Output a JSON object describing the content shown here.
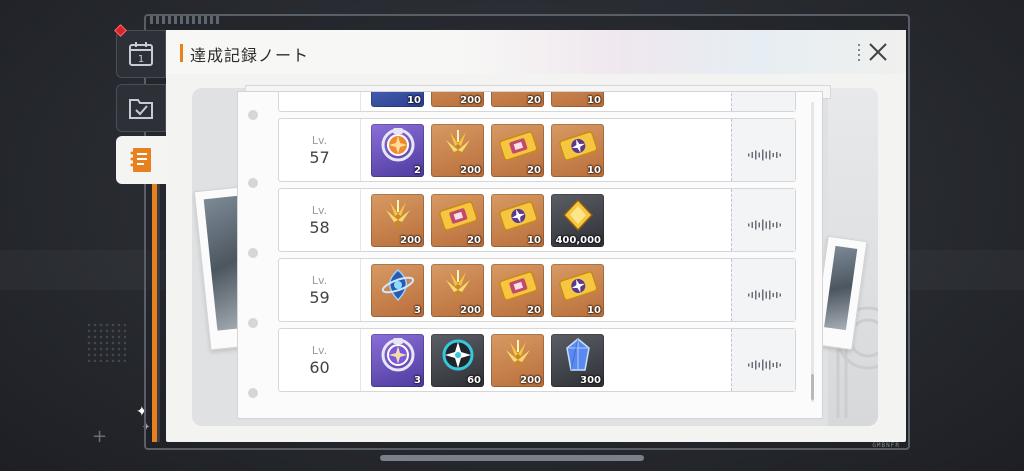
{
  "window": {
    "title": "達成記録ノート",
    "close_icon": "close-x-icon",
    "footer_code": "GMBNFR"
  },
  "tabs": [
    {
      "icon": "calendar-icon",
      "text": "1",
      "active": false,
      "badge": true
    },
    {
      "icon": "checklist-folder-icon",
      "active": false
    },
    {
      "icon": "notebook-icon",
      "active": true
    }
  ],
  "level_label": "Lv.",
  "rows": [
    {
      "level": "",
      "partial": true,
      "items": [
        {
          "icon": "ticket-blue-icon",
          "rarity": "blue",
          "qty": "10"
        },
        {
          "icon": "gold-sprout-icon",
          "rarity": "orange",
          "qty": "200"
        },
        {
          "icon": "gold-ticket-icon",
          "rarity": "orange",
          "qty": "20"
        },
        {
          "icon": "gold-ticket-star-icon",
          "rarity": "orange",
          "qty": "10"
        }
      ]
    },
    {
      "level": "57",
      "items": [
        {
          "icon": "pass-badge-orange-icon",
          "rarity": "purple",
          "qty": "2"
        },
        {
          "icon": "gold-sprout-icon",
          "rarity": "orange",
          "qty": "200"
        },
        {
          "icon": "gold-ticket-icon",
          "rarity": "orange",
          "qty": "20"
        },
        {
          "icon": "gold-ticket-star-icon",
          "rarity": "orange",
          "qty": "10"
        }
      ]
    },
    {
      "level": "58",
      "items": [
        {
          "icon": "gold-sprout-icon",
          "rarity": "orange",
          "qty": "200"
        },
        {
          "icon": "gold-ticket-icon",
          "rarity": "orange",
          "qty": "20"
        },
        {
          "icon": "gold-ticket-star-icon",
          "rarity": "orange",
          "qty": "10"
        },
        {
          "icon": "gold-coin-icon",
          "rarity": "dark",
          "qty": "400,000"
        }
      ]
    },
    {
      "level": "59",
      "items": [
        {
          "icon": "planet-drop-icon",
          "rarity": "orange",
          "qty": "3"
        },
        {
          "icon": "gold-sprout-icon",
          "rarity": "orange",
          "qty": "200"
        },
        {
          "icon": "gold-ticket-icon",
          "rarity": "orange",
          "qty": "20"
        },
        {
          "icon": "gold-ticket-star-icon",
          "rarity": "orange",
          "qty": "10"
        }
      ]
    },
    {
      "level": "60",
      "items": [
        {
          "icon": "pass-badge-purple-icon",
          "rarity": "purple",
          "qty": "3"
        },
        {
          "icon": "star-compass-icon",
          "rarity": "dark",
          "qty": "60"
        },
        {
          "icon": "gold-sprout-icon",
          "rarity": "orange",
          "qty": "200"
        },
        {
          "icon": "blue-crystal-icon",
          "rarity": "dark",
          "qty": "300"
        }
      ]
    }
  ],
  "colors": {
    "accent": "#e8801e",
    "badge_red": "#d8242a"
  }
}
